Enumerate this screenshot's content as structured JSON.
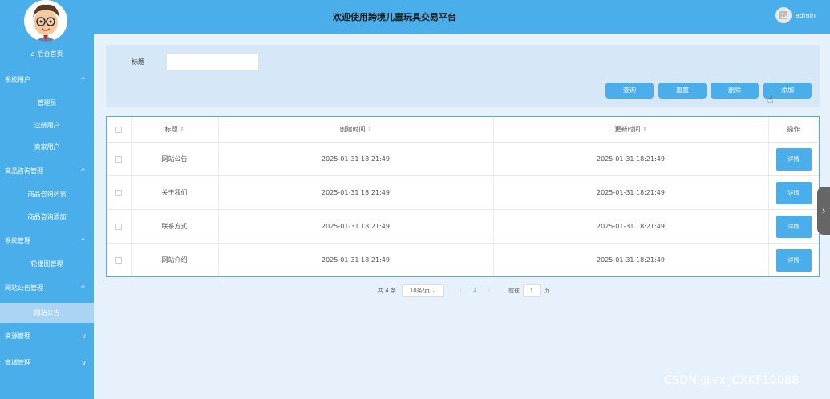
{
  "header": {
    "title": "欢迎使用跨境儿童玩具交易平台",
    "username": "admin"
  },
  "sidebar": {
    "home_label": "后台首页",
    "groups": [
      {
        "label": "系统用户",
        "chevron": "^",
        "items": [
          "管理员",
          "注册用户",
          "卖家用户"
        ]
      },
      {
        "label": "商品咨询管理",
        "chevron": "^",
        "items": [
          "商品咨询列表",
          "商品咨询添加"
        ]
      },
      {
        "label": "系统管理",
        "chevron": "^",
        "items": [
          "轮播图管理"
        ]
      },
      {
        "label": "网站公告管理",
        "chevron": "^",
        "items": [
          "网站公告"
        ]
      },
      {
        "label": "资源管理",
        "chevron": "v",
        "items": []
      },
      {
        "label": "商城管理",
        "chevron": "v",
        "items": []
      }
    ],
    "active_item": "网站公告"
  },
  "search": {
    "label": "标题",
    "value": "",
    "placeholder": ""
  },
  "actions": {
    "query": "查询",
    "reset": "重置",
    "delete": "删除",
    "add": "添加"
  },
  "table": {
    "columns": [
      "标题",
      "创建时间",
      "更新时间",
      "操作"
    ],
    "sort_glyph": "⇕",
    "rows": [
      {
        "title": "网站公告",
        "created": "2025-01-31 18:21:49",
        "updated": "2025-01-31 18:21:49",
        "action": "详情"
      },
      {
        "title": "关于我们",
        "created": "2025-01-31 18:21:49",
        "updated": "2025-01-31 18:21:49",
        "action": "详情"
      },
      {
        "title": "联系方式",
        "created": "2025-01-31 18:21:49",
        "updated": "2025-01-31 18:21:49",
        "action": "详情"
      },
      {
        "title": "网站介绍",
        "created": "2025-01-31 18:21:49",
        "updated": "2025-01-31 18:21:49",
        "action": "详情"
      }
    ]
  },
  "pagination": {
    "total": "共 4 条",
    "page_size": "10条/页",
    "current_page": "1",
    "goto_label": "前往",
    "goto_value": "1",
    "page_suffix": "页"
  },
  "watermark": "CSDN @vx_CXKF10088",
  "colors": {
    "primary": "#4aaeea",
    "panel": "#d6e8f7",
    "background": "#e6f1fb"
  }
}
